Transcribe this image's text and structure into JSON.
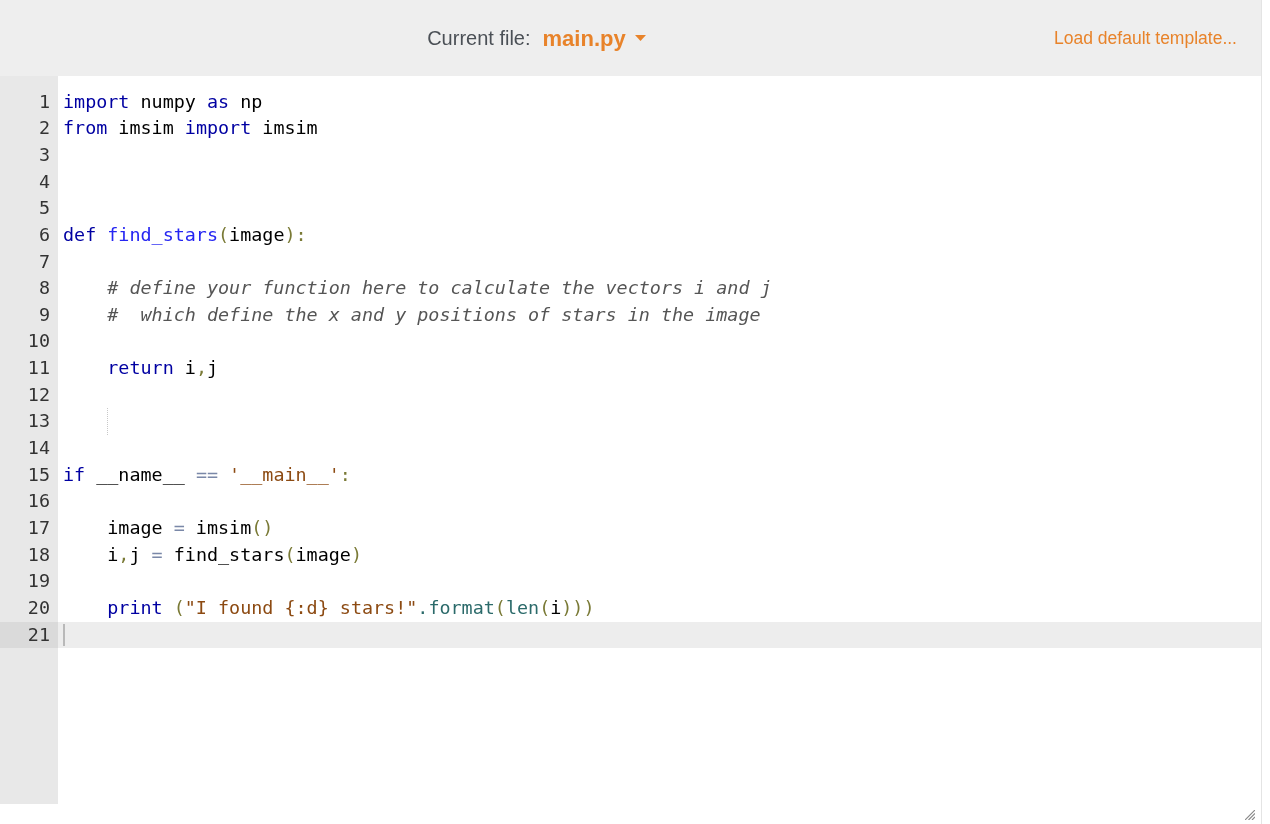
{
  "header": {
    "label": "Current file:",
    "file": "main.py",
    "action": "Load default template..."
  },
  "editor": {
    "lines": [
      {
        "number": "1",
        "active": false,
        "guide": false,
        "tokens": [
          {
            "kind": "keyword",
            "text": "import"
          },
          {
            "kind": "plain",
            "text": " numpy "
          },
          {
            "kind": "keyword",
            "text": "as"
          },
          {
            "kind": "plain",
            "text": " np"
          }
        ]
      },
      {
        "number": "2",
        "active": false,
        "guide": false,
        "tokens": [
          {
            "kind": "keyword",
            "text": "from"
          },
          {
            "kind": "plain",
            "text": " imsim "
          },
          {
            "kind": "keyword",
            "text": "import"
          },
          {
            "kind": "plain",
            "text": " imsim"
          }
        ]
      },
      {
        "number": "3",
        "active": false,
        "guide": false
      },
      {
        "number": "4",
        "active": false,
        "guide": false
      },
      {
        "number": "5",
        "active": false,
        "guide": false
      },
      {
        "number": "6",
        "active": false,
        "guide": false,
        "tokens": [
          {
            "kind": "keyword",
            "text": "def "
          },
          {
            "kind": "def",
            "text": "find_stars"
          },
          {
            "kind": "punct",
            "text": "("
          },
          {
            "kind": "plain",
            "text": "image"
          },
          {
            "kind": "punct",
            "text": "):"
          }
        ]
      },
      {
        "number": "7",
        "active": false,
        "guide": false
      },
      {
        "number": "8",
        "active": false,
        "guide": false,
        "tokens": [
          {
            "kind": "comment",
            "text": "    # define your function here to calculate the vectors i and j"
          }
        ]
      },
      {
        "number": "9",
        "active": false,
        "guide": false,
        "tokens": [
          {
            "kind": "comment",
            "text": "    #  which define the x and y positions of stars in the image"
          }
        ]
      },
      {
        "number": "10",
        "active": false,
        "guide": false
      },
      {
        "number": "11",
        "active": false,
        "guide": false,
        "tokens": [
          {
            "kind": "keyword",
            "text": "    return"
          },
          {
            "kind": "plain",
            "text": " i"
          },
          {
            "kind": "punct",
            "text": ","
          },
          {
            "kind": "plain",
            "text": "j"
          }
        ]
      },
      {
        "number": "12",
        "active": false,
        "guide": false
      },
      {
        "number": "13",
        "active": false,
        "guide": true
      },
      {
        "number": "14",
        "active": false,
        "guide": false
      },
      {
        "number": "15",
        "active": false,
        "guide": false,
        "tokens": [
          {
            "kind": "keyword",
            "text": "if"
          },
          {
            "kind": "plain",
            "text": " __name__ "
          },
          {
            "kind": "operator",
            "text": "== "
          },
          {
            "kind": "string",
            "text": "'__main__'"
          },
          {
            "kind": "punct",
            "text": ":"
          }
        ]
      },
      {
        "number": "16",
        "active": false,
        "guide": false
      },
      {
        "number": "17",
        "active": false,
        "guide": false,
        "tokens": [
          {
            "kind": "plain",
            "text": "    image "
          },
          {
            "kind": "operator",
            "text": "="
          },
          {
            "kind": "plain",
            "text": " imsim"
          },
          {
            "kind": "punct",
            "text": "()"
          }
        ]
      },
      {
        "number": "18",
        "active": false,
        "guide": false,
        "tokens": [
          {
            "kind": "plain",
            "text": "    i"
          },
          {
            "kind": "punct",
            "text": ","
          },
          {
            "kind": "plain",
            "text": "j "
          },
          {
            "kind": "operator",
            "text": "="
          },
          {
            "kind": "plain",
            "text": " find_stars"
          },
          {
            "kind": "punct",
            "text": "("
          },
          {
            "kind": "plain",
            "text": "image"
          },
          {
            "kind": "punct",
            "text": ")"
          }
        ]
      },
      {
        "number": "19",
        "active": false,
        "guide": false
      },
      {
        "number": "20",
        "active": false,
        "guide": false,
        "tokens": [
          {
            "kind": "keyword",
            "text": "    print "
          },
          {
            "kind": "punct",
            "text": "("
          },
          {
            "kind": "string",
            "text": "\"I found {:d} stars!\""
          },
          {
            "kind": "builtin",
            "text": ".format"
          },
          {
            "kind": "punct",
            "text": "("
          },
          {
            "kind": "builtin",
            "text": "len"
          },
          {
            "kind": "punct",
            "text": "("
          },
          {
            "kind": "plain",
            "text": "i"
          },
          {
            "kind": "punct",
            "text": ")))"
          }
        ]
      },
      {
        "number": "21",
        "active": true,
        "guide": false
      }
    ]
  }
}
